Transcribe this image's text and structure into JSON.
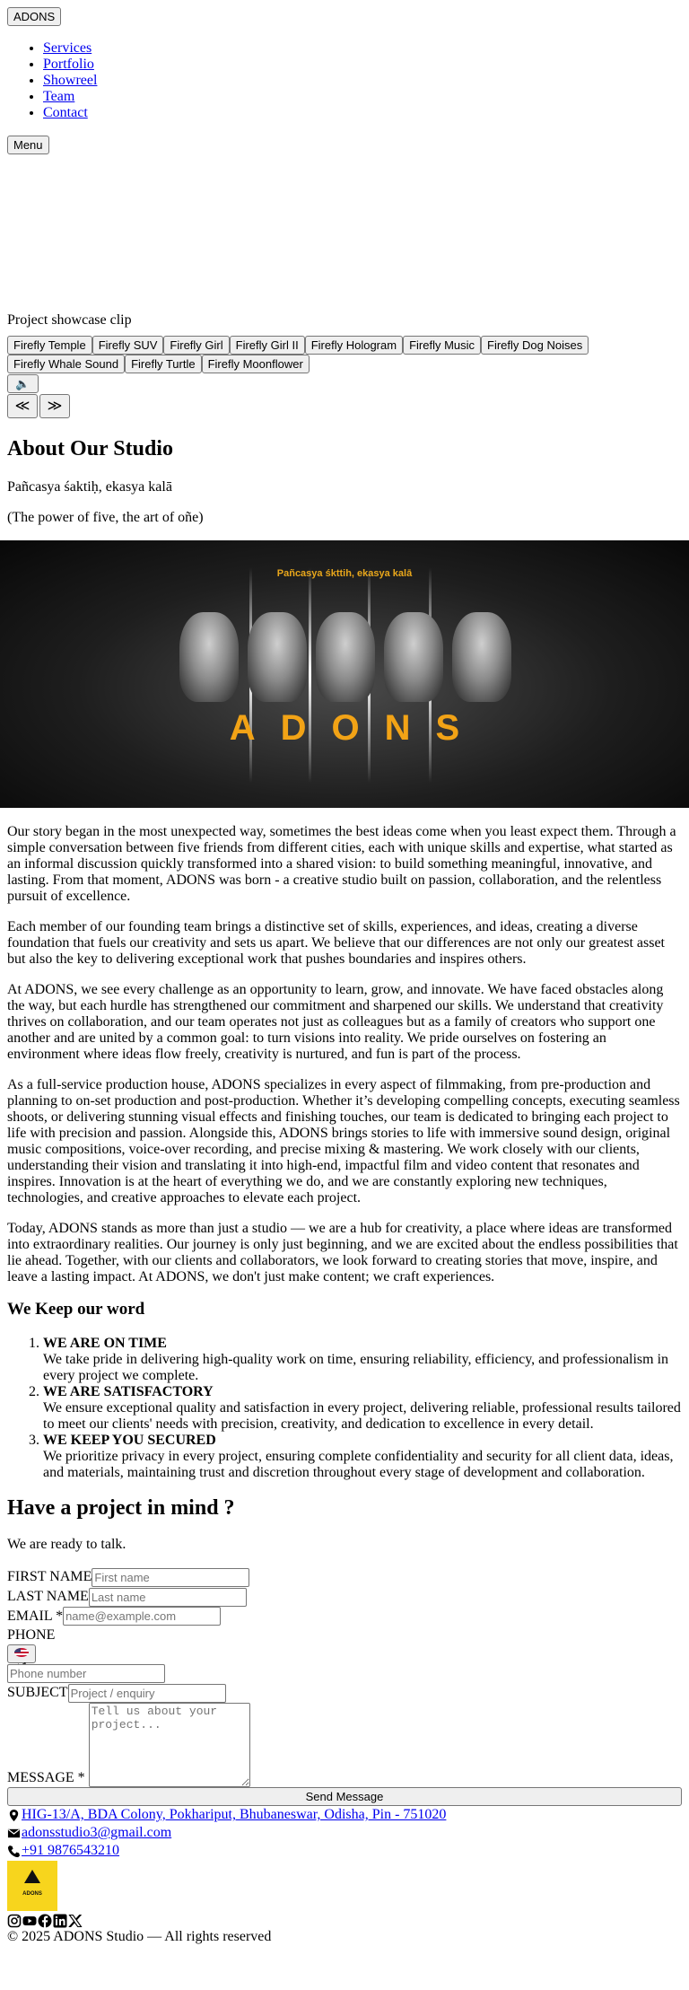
{
  "header": {
    "logo_label": "ADONS",
    "nav": [
      "Services",
      "Portfolio",
      "Showreel",
      "Team",
      "Contact"
    ],
    "menu_label": "Menu"
  },
  "showcase": {
    "video_label": "Project showcase clip",
    "clips": [
      "Firefly Temple",
      "Firefly SUV",
      "Firefly Girl",
      "Firefly Girl II",
      "Firefly Hologram",
      "Firefly Music",
      "Firefly Dog Noises",
      "Firefly Whale Sound",
      "Firefly Turtle",
      "Firefly Moonflower"
    ],
    "sound_label": "🔈✕",
    "prev_label": "≪",
    "next_label": "≫"
  },
  "about": {
    "title": "About Our Studio",
    "sanskrit": "Pañcasya śaktiḥ, ekasya kalā",
    "translation": "(The power of five, the art of oñe)",
    "hero_tagline": "Pañcasya śkttih, ekasya kalā",
    "hero_brand": "ADONS",
    "paragraphs": [
      "Our story began in the most unexpected way, sometimes the best ideas come when you least expect them. Through a simple conversation between five friends from different cities, each with unique skills and expertise, what started as an informal discussion quickly transformed into a shared vision: to build something meaningful, innovative, and lasting. From that moment, ADONS was born - a creative studio built on passion, collaboration, and the relentless pursuit of excellence.",
      "Each member of our founding team brings a distinctive set of skills, experiences, and ideas, creating a diverse foundation that fuels our creativity and sets us apart. We believe that our differences are not only our greatest asset but also the key to delivering exceptional work that pushes boundaries and inspires others.",
      "At ADONS, we see every challenge as an opportunity to learn, grow, and innovate. We have faced obstacles along the way, but each hurdle has strengthened our commitment and sharpened our skills. We understand that creativity thrives on collaboration, and our team operates not just as colleagues but as a family of creators who support one another and are united by a common goal: to turn visions into reality. We pride ourselves on fostering an environment where ideas flow freely, creativity is nurtured, and fun is part of the process.",
      "As a full-service production house, ADONS specializes in every aspect of filmmaking, from pre-production and planning to on-set production and post-production. Whether it’s developing compelling concepts, executing seamless shoots, or delivering stunning visual effects and finishing touches, our team is dedicated to bringing each project to life with precision and passion. Alongside this, ADONS brings stories to life with immersive sound design, original music compositions, voice-over recording, and precise mixing & mastering. We work closely with our clients, understanding their vision and translating it into high-end, impactful film and video content that resonates and inspires. Innovation is at the heart of everything we do, and we are constantly exploring new techniques, technologies, and creative approaches to elevate each project.",
      "Today, ADONS stands as more than just a studio — we are a hub for creativity, a place where ideas are transformed into extraordinary realities. Our journey is only just beginning, and we are excited about the endless possibilities that lie ahead. Together, with our clients and collaborators, we look forward to creating stories that move, inspire, and leave a lasting impact. At ADONS, we don't just make content; we craft experiences."
    ]
  },
  "promises": {
    "title": "We Keep our word",
    "items": [
      {
        "title": "WE ARE ON TIME",
        "text": "We take pride in delivering high-quality work on time, ensuring reliability, efficiency, and professionalism in every project we complete."
      },
      {
        "title": "WE ARE SATISFACTORY",
        "text": "We ensure exceptional quality and satisfaction in every project, delivering reliable, professional results tailored to meet our clients' needs with precision, creativity, and dedication to excellence in every detail."
      },
      {
        "title": "WE KEEP YOU SECURED",
        "text": "We prioritize privacy in every project, ensuring complete confidentiality and security for all client data, ideas, and materials, maintaining trust and discretion throughout every stage of development and collaboration."
      }
    ]
  },
  "contact_form": {
    "title": "Have a project in mind ?",
    "subtitle": "We are ready to talk.",
    "first_name_label": "FIRST NAME",
    "first_name_placeholder": "First name",
    "last_name_label": "LAST NAME",
    "last_name_placeholder": "Last name",
    "email_label": "EMAIL *",
    "email_placeholder": "name@example.com",
    "phone_label": "PHONE",
    "country_code": "+1",
    "phone_placeholder": "Phone number",
    "subject_label": "SUBJECT",
    "subject_placeholder": "Project / enquiry",
    "message_label": "MESSAGE *",
    "message_placeholder": "Tell us about your project...",
    "send_label": "Send Message"
  },
  "footer": {
    "address": "HIG-13/A, BDA Colony, Pokhariput, Bhubaneswar, Odisha, Pin - 751020",
    "email": "adonsstudio3@gmail.com",
    "phone": "+91 9876543210",
    "logo_text": "ADONS",
    "socials": [
      "instagram-icon",
      "youtube-icon",
      "facebook-icon",
      "linkedin-icon",
      "x-icon"
    ],
    "copyright": "© 2025 ADONS Studio — All rights reserved",
    "logo_color": "#f7d51d"
  }
}
